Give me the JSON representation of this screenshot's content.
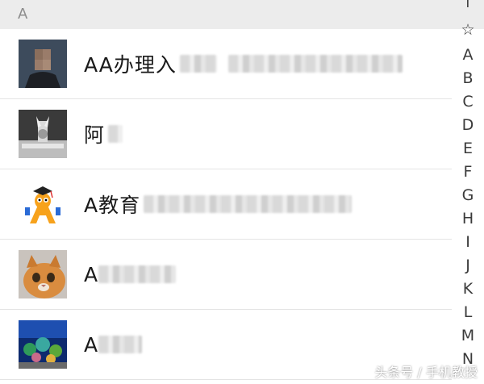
{
  "section": {
    "letter": "A"
  },
  "contacts": [
    {
      "name": "AA办理入",
      "avatar": "person-photo-avatar"
    },
    {
      "name": "阿",
      "avatar": "car-emblem-avatar"
    },
    {
      "name": "A教育",
      "avatar": "cartoon-mascot-avatar"
    },
    {
      "name": "A",
      "avatar": "cat-photo-avatar"
    },
    {
      "name": "A",
      "avatar": "aquarium-photo-avatar"
    }
  ],
  "index_bar": [
    "↑",
    "☆",
    "A",
    "B",
    "C",
    "D",
    "E",
    "F",
    "G",
    "H",
    "I",
    "J",
    "K",
    "L",
    "M",
    "N"
  ],
  "watermark": "头条号 / 手机教授"
}
